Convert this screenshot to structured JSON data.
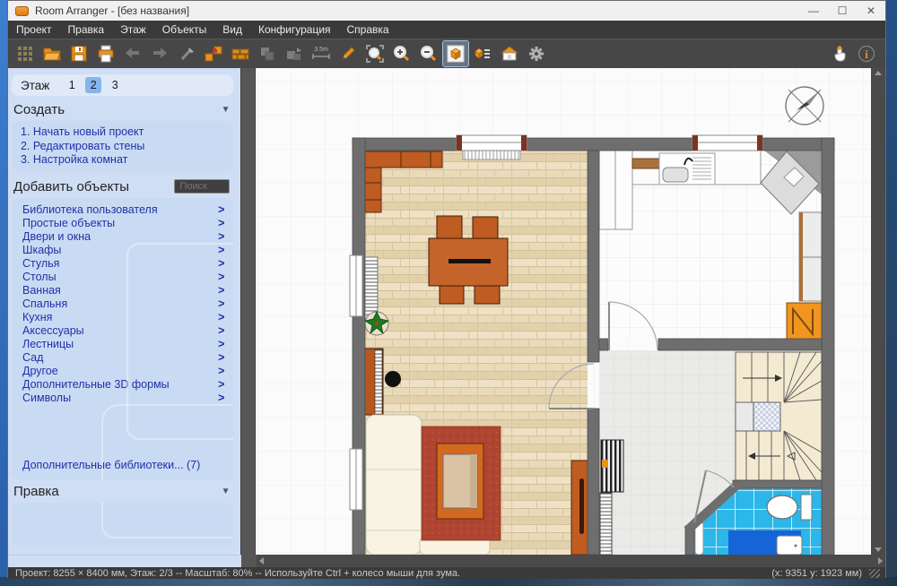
{
  "window": {
    "title": "Room Arranger - [без названия]",
    "controls": {
      "minimize": "—",
      "maximize": "☐",
      "close": "✕"
    }
  },
  "menu": {
    "items": [
      "Проект",
      "Правка",
      "Этаж",
      "Объекты",
      "Вид",
      "Конфигурация",
      "Справка"
    ]
  },
  "toolbar": {
    "measure_label": "3.5m",
    "buttons": [
      "project-grid",
      "open",
      "save",
      "print",
      "undo",
      "redo",
      "clean",
      "wall-editor",
      "bricks",
      "select-objects",
      "group-objects",
      "measure",
      "pencil",
      "zoom-fit",
      "zoom-in",
      "zoom-out",
      "view-3d",
      "object-list",
      "walls-3d",
      "settings",
      "pointer",
      "info"
    ],
    "selected_button": "view-3d"
  },
  "sidebar": {
    "floor_label": "Этаж",
    "floors": [
      "1",
      "2",
      "3"
    ],
    "active_floor": "2",
    "create": {
      "header": "Создать",
      "steps": [
        "1. Начать новый проект",
        "2. Редактировать стены",
        "3. Настройка комнат"
      ]
    },
    "add_objects": {
      "header": "Добавить объекты",
      "search_placeholder": "Поиск",
      "arrow": ">",
      "categories": [
        "Библиотека пользователя",
        "Простые объекты",
        "Двери и окна",
        "Шкафы",
        "Стулья",
        "Столы",
        "Ванная",
        "Спальня",
        "Кухня",
        "Аксессуары",
        "Лестницы",
        "Сад",
        "Другое",
        "Дополнительные 3D формы",
        "Символы"
      ]
    },
    "libraries_link": "Дополнительные библиотеки... (7)",
    "edit": {
      "header": "Правка"
    },
    "collapse_arrow": "▼"
  },
  "statusbar": {
    "left": "Проект: 8255 × 8400 мм, Этаж: 2/3 -- Масштаб: 80% -- Используйте Ctrl + колесо мыши для зума.",
    "right": "(x: 9351 y: 1923 мм)"
  },
  "colors": {
    "accent_orange": "#e8921e",
    "selection_blue": "#85b5ec",
    "wall_gray": "#6e6e6e",
    "bath_blue": "#2bb7e9",
    "wood_tan": "#e9dab9",
    "carpet_red": "#b04531",
    "sidebar_blue": "#cfdef5",
    "link_navy": "#2030a8"
  }
}
